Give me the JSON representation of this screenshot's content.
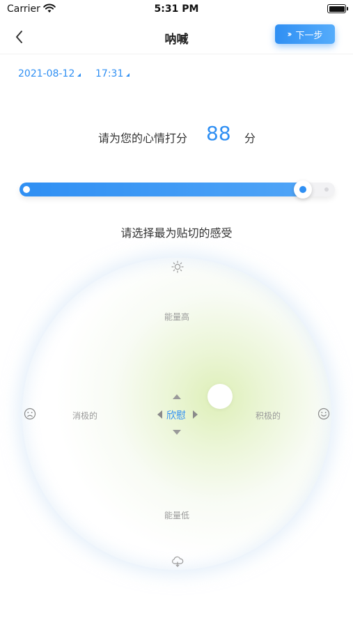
{
  "status_bar": {
    "carrier": "Carrier",
    "time": "5:31 PM"
  },
  "nav": {
    "title": "呐喊",
    "next_label": "下一步",
    "next_icon": "double-chevron-right-icon"
  },
  "entry": {
    "date": "2021-08-12",
    "time": "17:31"
  },
  "score": {
    "prompt": "请为您的心情打分",
    "value": "88",
    "unit": "分",
    "slider_fraction": 0.88
  },
  "mood": {
    "prompt": "请选择最为贴切的感受",
    "top_label": "能量高",
    "bottom_label": "能量低",
    "left_label": "消极的",
    "right_label": "积极的",
    "current": "欣慰",
    "colors": {
      "accent": "#2f8ff3",
      "glow": "#dceeb4"
    }
  }
}
